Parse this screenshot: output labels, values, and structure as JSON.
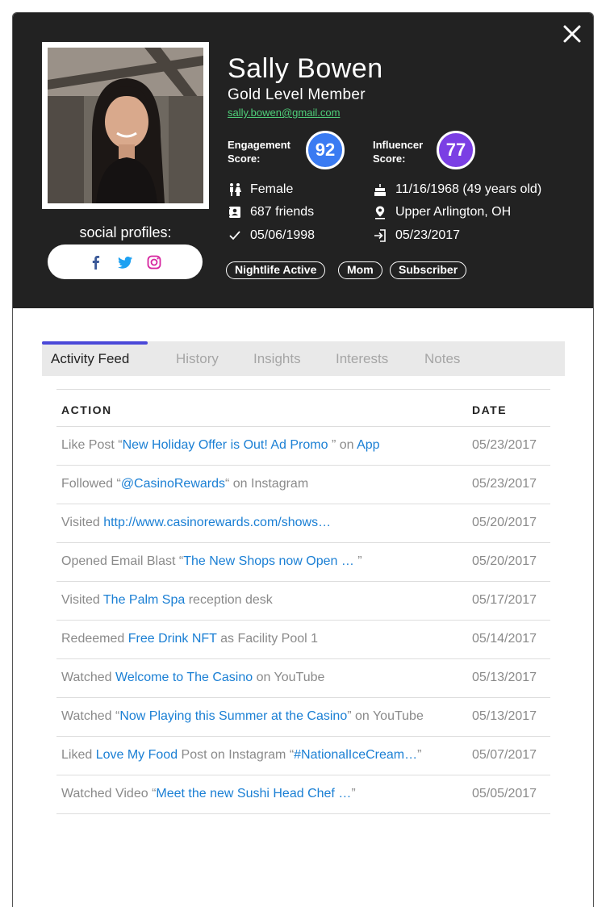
{
  "profile": {
    "name": "Sally Bowen",
    "level": "Gold Level Member",
    "email": "sally.bowen@gmail.com",
    "social_label": "social profiles:",
    "engagement_label_1": "Engagement",
    "engagement_label_2": "Score:",
    "engagement_score": "92",
    "influencer_label_1": "Influencer",
    "influencer_label_2": "Score:",
    "influencer_score": "77",
    "gender": "Female",
    "friends": "687 friends",
    "member_since": "05/06/1998",
    "birthday": "11/16/1968 (49 years old)",
    "location": "Upper Arlington, OH",
    "last_login": "05/23/2017",
    "tags": [
      "Nightlife Active",
      "Mom",
      "Subscriber"
    ]
  },
  "colors": {
    "header_bg": "#222222",
    "engagement": "#3a7bf2",
    "influencer": "#7b3fe4",
    "email": "#4fd07a",
    "link": "#1a7fd4",
    "tab_indicator": "#4a48d8"
  },
  "icons": [
    "close-icon",
    "facebook-icon",
    "twitter-icon",
    "instagram-icon",
    "gender-icon",
    "contacts-icon",
    "check-icon",
    "cake-icon",
    "location-pin-icon",
    "login-icon"
  ],
  "tabs": [
    "Activity Feed",
    "History",
    "Insights",
    "Interests",
    "Notes"
  ],
  "table": {
    "header_action": "ACTION",
    "header_date": "DATE",
    "rows": [
      {
        "p1": "Like Post  “",
        "l1": "New Holiday Offer is Out! Ad Promo ",
        "p2": "” on ",
        "l2": "App",
        "p3": "",
        "date": "05/23/2017"
      },
      {
        "p1": "Followed  “",
        "l1": "@CasinoRewards",
        "p2": "“ on Instagram",
        "l2": "",
        "p3": "",
        "date": "05/23/2017"
      },
      {
        "p1": "Visited ",
        "l1": "http://www.casinorewards.com/shows…",
        "p2": "",
        "l2": "",
        "p3": "",
        "date": "05/20/2017"
      },
      {
        "p1": "Opened Email Blast  “",
        "l1": "The New Shops now Open … ",
        "p2": "”",
        "l2": "",
        "p3": "",
        "date": "05/20/2017"
      },
      {
        "p1": "Visited ",
        "l1": "The Palm Spa",
        "p2": " reception desk",
        "l2": "",
        "p3": "",
        "date": "05/17/2017"
      },
      {
        "p1": "Redeemed ",
        "l1": "Free Drink NFT",
        "p2": " as Facility Pool 1",
        "l2": "",
        "p3": "",
        "date": "05/14/2017"
      },
      {
        "p1": "Watched  ",
        "l1": "Welcome to The Casino",
        "p2": " on YouTube",
        "l2": "",
        "p3": "",
        "date": "05/13/2017"
      },
      {
        "p1": "Watched  “",
        "l1": "Now Playing this Summer at the Casino",
        "p2": "” on YouTube",
        "l2": "",
        "p3": "",
        "date": "05/13/2017"
      },
      {
        "p1": "Liked ",
        "l1": "Love My Food",
        "p2": " Post on Instagram  “",
        "l2": "#NationalIceCream…",
        "p3": "”",
        "date": "05/07/2017"
      },
      {
        "p1": "Watched Video  “",
        "l1": "Meet the new Sushi Head Chef …",
        "p2": "”",
        "l2": "",
        "p3": "",
        "date": "05/05/2017"
      }
    ]
  }
}
